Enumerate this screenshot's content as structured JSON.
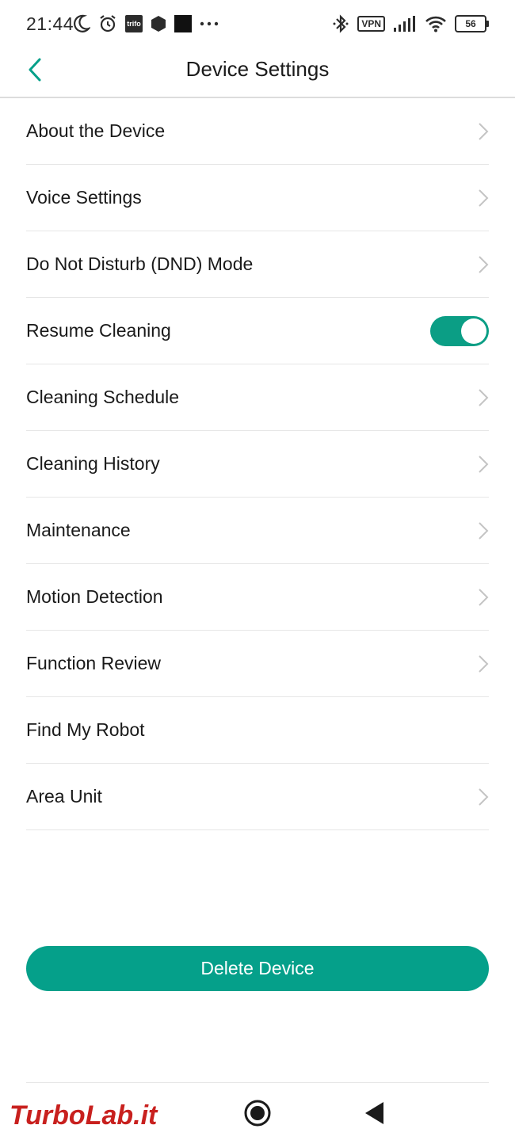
{
  "status_bar": {
    "time": "21:44",
    "left_icons": [
      "moon-icon",
      "alarm-icon",
      "trifo-app-icon",
      "hexagon-icon",
      "square-icon",
      "more-dots-icon"
    ],
    "trifo_label": "trifo",
    "vpn_label": "VPN",
    "battery_level": "56",
    "right_icons": [
      "bluetooth-icon",
      "vpn-badge",
      "signal-icon",
      "wifi-icon",
      "battery-icon"
    ]
  },
  "header": {
    "title": "Device Settings",
    "back_icon": "chevron-left-icon"
  },
  "settings": {
    "items": [
      {
        "label": "About the Device",
        "control": "chevron"
      },
      {
        "label": "Voice Settings",
        "control": "chevron"
      },
      {
        "label": "Do Not Disturb (DND) Mode",
        "control": "chevron"
      },
      {
        "label": "Resume Cleaning",
        "control": "toggle",
        "toggle_on": true
      },
      {
        "label": "Cleaning Schedule",
        "control": "chevron"
      },
      {
        "label": "Cleaning History",
        "control": "chevron"
      },
      {
        "label": "Maintenance",
        "control": "chevron"
      },
      {
        "label": "Motion Detection",
        "control": "chevron"
      },
      {
        "label": "Function Review",
        "control": "chevron"
      },
      {
        "label": "Find My Robot",
        "control": "none"
      },
      {
        "label": "Area Unit",
        "control": "chevron"
      }
    ]
  },
  "actions": {
    "delete_label": "Delete Device"
  },
  "nav": {
    "home_icon": "home-circle-icon",
    "back_icon": "back-triangle-icon"
  },
  "watermark": {
    "text": "TurboLab.it"
  },
  "colors": {
    "accent": "#05a08a",
    "toggle_on": "#0b9e85",
    "text": "#1a1a1a",
    "divider": "#e6e6e6",
    "chevron": "#c4c4c4",
    "watermark_red": "#c8201e"
  }
}
